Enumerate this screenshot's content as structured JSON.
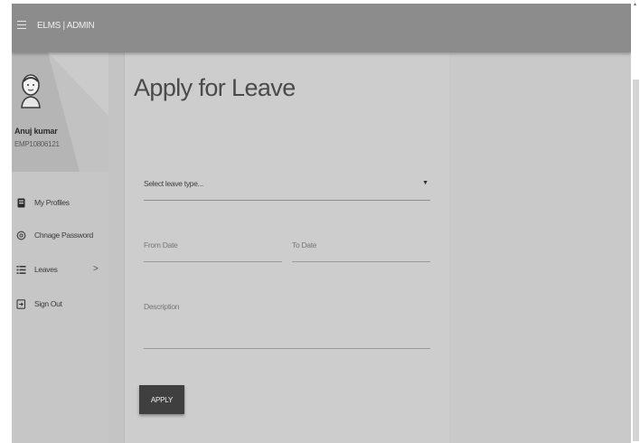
{
  "app": {
    "brand": "ELMS | ADMIN"
  },
  "user": {
    "name": "Anuj kumar",
    "id": "EMP10806121"
  },
  "sidebar": {
    "items": [
      {
        "label": "My Profiles",
        "icon": "profile-card-icon"
      },
      {
        "label": "Chnage Password",
        "icon": "settings-icon"
      },
      {
        "label": "Leaves",
        "icon": "list-icon",
        "arrow": ">"
      },
      {
        "label": "Sign Out",
        "icon": "sign-out-icon"
      }
    ]
  },
  "main": {
    "title": "Apply for Leave",
    "leave_type_placeholder": "Select leave type...",
    "from_date_placeholder": "From Date",
    "to_date_placeholder": "To Date",
    "description_placeholder": "Description",
    "apply_label": "APPLY"
  },
  "colors": {
    "topbar": "#8c8c8c",
    "background": "#c9c9c9",
    "button": "#3f3f3f"
  }
}
